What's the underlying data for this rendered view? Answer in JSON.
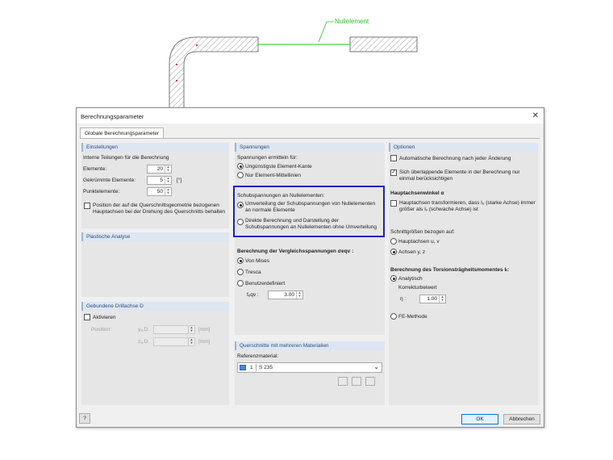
{
  "diagram": {
    "annotation": "Nullelement"
  },
  "dialog": {
    "title": "Berechnungsparameter",
    "tab": "Globale Berechnungsparameter",
    "einstellungen": {
      "header": "Einstellungen",
      "teilungen_label": "Interne Teilungen für die Berechnung",
      "elemente_label": "Elemente:",
      "elemente_value": "20",
      "gekruemmte_label": "Gekrümmte Elemente:",
      "gekruemmte_value": "5",
      "gekruemmte_unit": "[°]",
      "punkt_label": "Punktelemente:",
      "punkt_value": "50",
      "position_checkbox": "Position der auf die Querschnittsgeometrie bezogenen Hauptachsen bei der Drehung des Querschnitts behalten"
    },
    "plastische": {
      "header": "Plastische Analyse"
    },
    "drillachse": {
      "header": "Gebundene Drillachse D",
      "aktivieren": "Aktivieren",
      "position_label": "Position:",
      "y_label": "yₐ,D:",
      "z_label": "zₐ,D:",
      "unit": "[mm]"
    },
    "spannungen": {
      "header": "Spannungen",
      "ermitteln_label": "Spannungen ermitteln für:",
      "opt_kante": "Ungünstigste Element-Kante",
      "opt_mittel": "Nur Element-Mittellinien",
      "schub_label": "Schubspannungen an Nullelementen:",
      "schub_opt1": "Umverteilung der Schubspannungen von Nullelementen an normale Elemente",
      "schub_opt2": "Direkte Berechnung und Darstellung der Schubspannungen an Nullelementen ohne Umverteilung",
      "vergleich_label": "Berechnung der Vergleichsspannungen σeqv :",
      "opt_mises": "Von Mises",
      "opt_tresca": "Tresca",
      "opt_benutzer": "Benutzerdefiniert",
      "feqv_label": "fₑqv :",
      "feqv_value": "3.00"
    },
    "material": {
      "header": "Querschnitte mit mehreren Materialien",
      "ref_label": "Referenzmaterial:",
      "ref_number": "1",
      "ref_value": "S 235",
      "swatch_color": "#4a8ad4"
    },
    "optionen": {
      "header": "Optionen",
      "auto": "Automatische Berechnung nach jeder Änderung",
      "ueberlapp": "Sich überlappende Elemente in der Berechnung nur einmal berücksichtigen",
      "hauptwinkel_label": "Hauptachsenwinkel α",
      "transform": "Hauptachsen transformieren, dass Iᵤ (starke Achse) immer größer als Iᵥ (schwache Achse) ist",
      "schnitt_label": "Schnittgrößen bezogen auf:",
      "opt_uv": "Hauptachsen u, v",
      "opt_yz": "Achsen y, z",
      "torsion_label": "Berechnung des Torsionsträgheitsmomentes Iₜ:",
      "opt_analytisch": "Analytisch",
      "korr_label": "Korrekturbeiwert",
      "eta_label": "η :",
      "eta_value": "1.00",
      "opt_fe": "FE-Methode"
    },
    "ok": "OK",
    "cancel": "Abbrechen"
  }
}
